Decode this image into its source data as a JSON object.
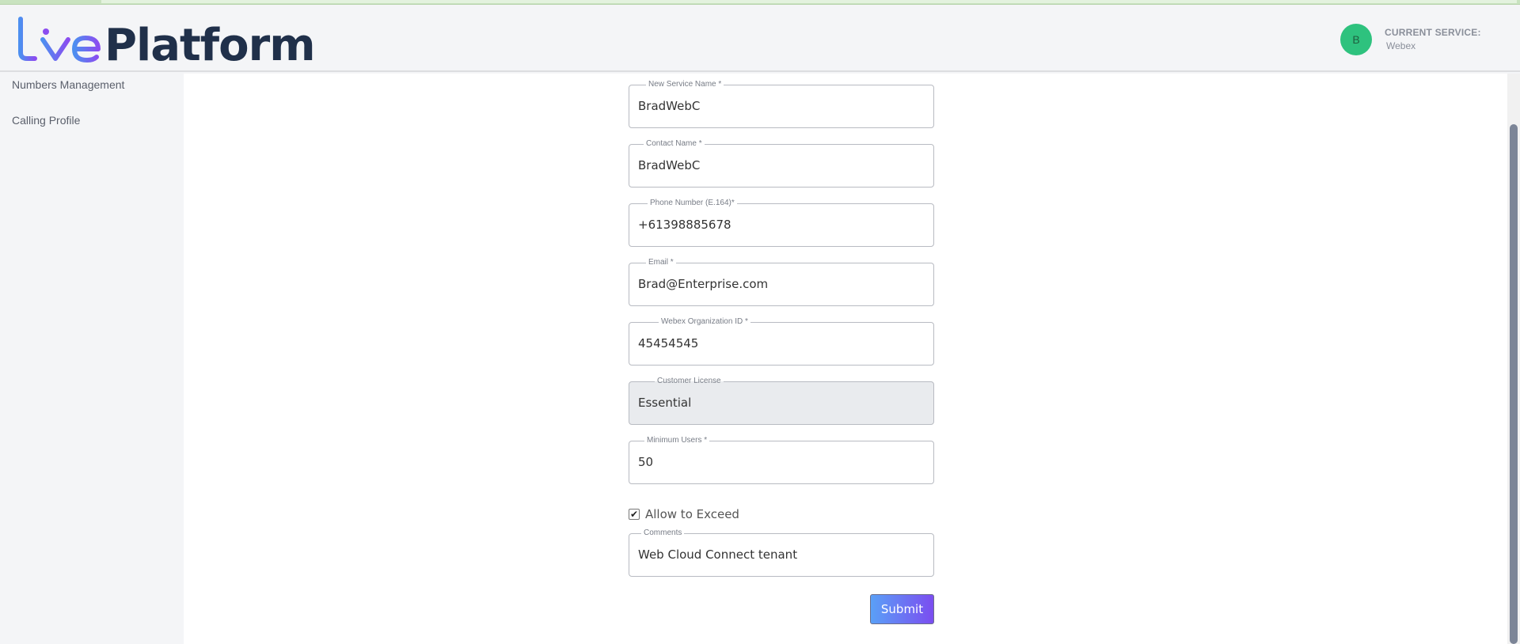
{
  "header": {
    "logo_text": "Platform",
    "avatar_initial": "B",
    "current_service_label": "CURRENT SERVICE:",
    "current_service_value": "Webex"
  },
  "sidebar": {
    "items": [
      {
        "label": "Numbers Management"
      },
      {
        "label": "Calling Profile"
      }
    ]
  },
  "form": {
    "fields": [
      {
        "label": "New Service Name *",
        "value": "BradWebC",
        "disabled": false
      },
      {
        "label": "Contact Name *",
        "value": "BradWebC",
        "disabled": false
      },
      {
        "label": "Phone Number (E.164)*",
        "value": "+61398885678",
        "disabled": false
      },
      {
        "label": "Email *",
        "value": "Brad@Enterprise.com",
        "disabled": false
      },
      {
        "label": "Webex Organization ID *",
        "value": "45454545",
        "disabled": false
      },
      {
        "label": "Customer License",
        "value": "Essential",
        "disabled": true
      },
      {
        "label": "Minimum Users *",
        "value": "50",
        "disabled": false
      }
    ],
    "allow_exceed": {
      "label": "Allow to Exceed",
      "checked": true
    },
    "comments": {
      "label": "Comments",
      "value": "Web Cloud Connect tenant"
    },
    "submit_label": "Submit"
  },
  "colors": {
    "avatar": "#2ec27e",
    "submit_gradient_start": "#5aa0f7",
    "submit_gradient_end": "#7b4df0"
  }
}
